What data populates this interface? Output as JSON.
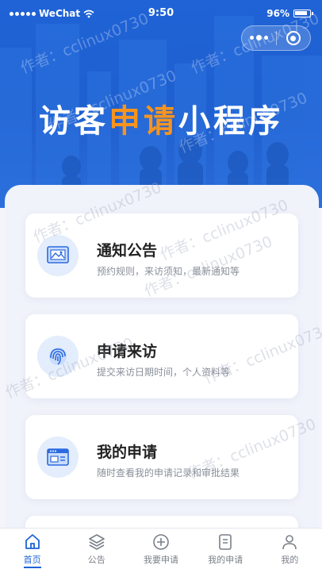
{
  "status_bar": {
    "carrier": "WeChat",
    "time": "9:50",
    "battery": "96%"
  },
  "capsule": {
    "more_icon": "more-icon",
    "close_icon": "close-target-icon"
  },
  "hero": {
    "title_part1": "访客",
    "title_highlight": "申请",
    "title_part2": "小程序",
    "highlight_color": "#f7941d",
    "background_color": "#1f63d6"
  },
  "watermark": "作者：cclinux0730",
  "cards": [
    {
      "title": "通知公告",
      "subtitle": "预约规则，来访须知，最新通知等",
      "icon": "notice-image-icon"
    },
    {
      "title": "申请来访",
      "subtitle": "提交来访日期时间，个人资料等",
      "icon": "fingerprint-icon"
    },
    {
      "title": "我的申请",
      "subtitle": "随时查看我的申请记录和审批结果",
      "icon": "id-card-icon"
    }
  ],
  "tabbar": {
    "active_color": "#1f63d6",
    "items": [
      {
        "label": "首页",
        "icon": "home-icon",
        "active": true
      },
      {
        "label": "公告",
        "icon": "layers-icon",
        "active": false
      },
      {
        "label": "我要申请",
        "icon": "plus-circle-icon",
        "active": false
      },
      {
        "label": "我的申请",
        "icon": "document-icon",
        "active": false
      },
      {
        "label": "我的",
        "icon": "user-icon",
        "active": false
      }
    ]
  }
}
